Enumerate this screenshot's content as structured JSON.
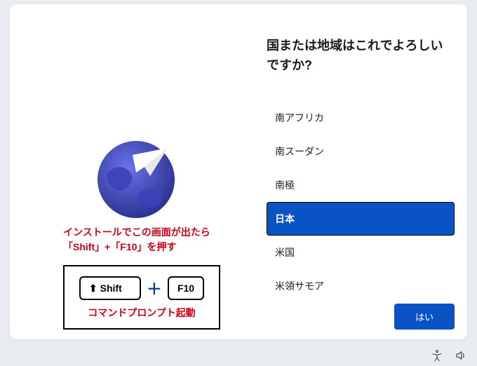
{
  "heading": "国または地域はこれでよろしいですか?",
  "region_list": {
    "items": [
      {
        "label": "南アフリカ",
        "selected": false
      },
      {
        "label": "南スーダン",
        "selected": false
      },
      {
        "label": "南極",
        "selected": false
      },
      {
        "label": "日本",
        "selected": true
      },
      {
        "label": "米国",
        "selected": false
      },
      {
        "label": "米領サモア",
        "selected": false
      }
    ]
  },
  "primary_button": "はい",
  "annotation": {
    "line1": "インストールでこの画面が出たら",
    "line2": "「Shift」+「F10」を押す",
    "shift_key": "Shift",
    "f10_key": "F10",
    "plus": "＋",
    "caption": "コマンドプロンプト起動"
  },
  "icons": {
    "globe": "globe-icon",
    "plane": "paper-plane-icon",
    "accessibility": "accessibility-icon",
    "volume": "volume-icon",
    "shift_arrow": "⬆"
  },
  "colors": {
    "accent": "#0a53c5",
    "annotation": "#d4001a",
    "globe_dark": "#2a2f8e",
    "globe_light": "#5961d8"
  }
}
